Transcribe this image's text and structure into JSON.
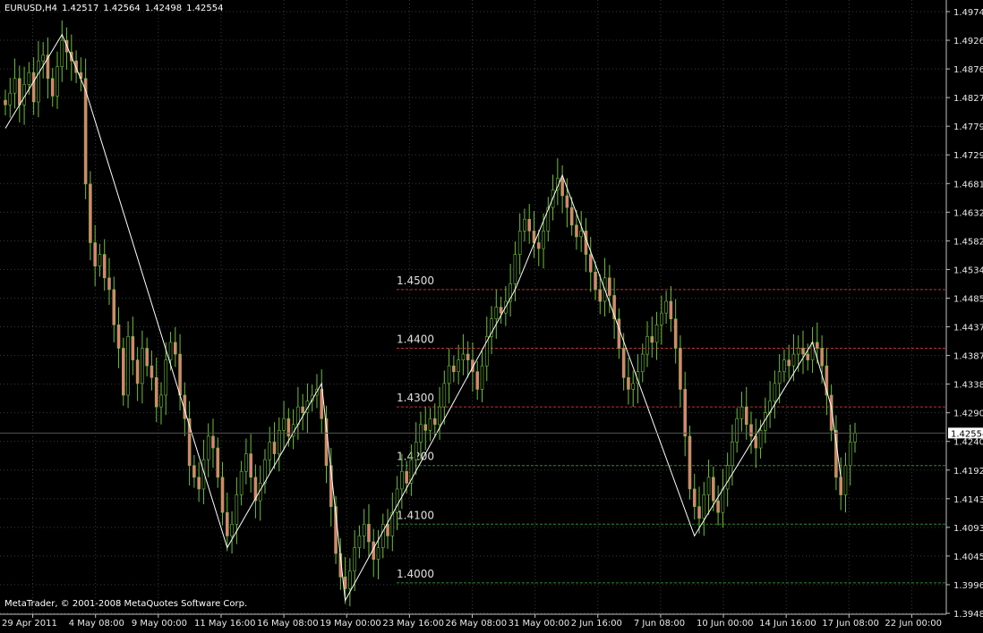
{
  "header": {
    "symbol": "EURUSD,H4",
    "open": "1.42517",
    "high": "1.42564",
    "low": "1.42498",
    "close": "1.42554"
  },
  "footer": "MetaTrader, © 2001-2008 MetaQuotes Software Corp.",
  "colors": {
    "background": "#000000",
    "grid": "#3a3a3a",
    "axis": "#c0c0c0",
    "candle": "#6fbf3a",
    "bull_body": "#6fbf3a",
    "bear_body": "#f07878",
    "zigzag": "#ffffff",
    "level_red": "#c03030",
    "level_green": "#2e8b2e",
    "price_tag_bg": "#ffffff"
  },
  "chart_data": {
    "type": "candlestick",
    "ylim": [
      1.3948,
      1.4974
    ],
    "y_ticks": [
      "1.49740",
      "1.49260",
      "1.48765",
      "1.48270",
      "1.47790",
      "1.47295",
      "1.46815",
      "1.46320",
      "1.45825",
      "1.45345",
      "1.44850",
      "1.44370",
      "1.43875",
      "1.43380",
      "1.42900",
      "1.42405",
      "1.41925",
      "1.41430",
      "1.40935",
      "1.40455",
      "1.39960",
      "1.39480"
    ],
    "x_ticks": [
      "29 Apr 2011",
      "4 May 08:00",
      "9 May 00:00",
      "11 May 16:00",
      "16 May 08:00",
      "19 May 00:00",
      "23 May 16:00",
      "26 May 08:00",
      "31 May 00:00",
      "2 Jun 16:00",
      "7 Jun 08:00",
      "10 Jun 00:00",
      "14 Jun 16:00",
      "17 Jun 08:00",
      "22 Jun 00:00"
    ],
    "current_price": "1.42554",
    "levels": [
      {
        "label": "1.4500",
        "price": 1.45,
        "color": "red"
      },
      {
        "label": "1.4400",
        "price": 1.44,
        "color": "red"
      },
      {
        "label": "1.4300",
        "price": 1.43,
        "color": "red"
      },
      {
        "label": "1.4200",
        "price": 1.42,
        "color": "green"
      },
      {
        "label": "1.4100",
        "price": 1.41,
        "color": "green"
      },
      {
        "label": "1.4000",
        "price": 1.4,
        "color": "green"
      }
    ],
    "zigzag_prices": [
      1.4775,
      1.4935,
      1.484,
      1.406,
      1.434,
      1.397,
      1.45,
      1.4695,
      1.45,
      1.408,
      1.441,
      1.43,
      1.418
    ],
    "closes": [
      1.4815,
      1.4835,
      1.486,
      1.4815,
      1.485,
      1.487,
      1.482,
      1.489,
      1.49,
      1.486,
      1.483,
      1.488,
      1.4925,
      1.4905,
      1.489,
      1.487,
      1.486,
      1.468,
      1.458,
      1.454,
      1.456,
      1.452,
      1.45,
      1.444,
      1.44,
      1.432,
      1.442,
      1.438,
      1.434,
      1.44,
      1.437,
      1.435,
      1.43,
      1.432,
      1.438,
      1.441,
      1.439,
      1.432,
      1.428,
      1.42,
      1.418,
      1.416,
      1.421,
      1.425,
      1.423,
      1.418,
      1.412,
      1.408,
      1.41,
      1.415,
      1.419,
      1.422,
      1.418,
      1.414,
      1.417,
      1.421,
      1.424,
      1.422,
      1.426,
      1.428,
      1.425,
      1.427,
      1.43,
      1.429,
      1.431,
      1.432,
      1.433,
      1.428,
      1.42,
      1.413,
      1.405,
      1.401,
      1.399,
      1.402,
      1.406,
      1.408,
      1.41,
      1.407,
      1.404,
      1.406,
      1.41,
      1.408,
      1.412,
      1.416,
      1.419,
      1.417,
      1.421,
      1.424,
      1.427,
      1.426,
      1.428,
      1.427,
      1.43,
      1.434,
      1.437,
      1.436,
      1.438,
      1.439,
      1.438,
      1.436,
      1.433,
      1.437,
      1.442,
      1.445,
      1.447,
      1.446,
      1.448,
      1.451,
      1.456,
      1.46,
      1.462,
      1.46,
      1.458,
      1.457,
      1.46,
      1.464,
      1.467,
      1.469,
      1.466,
      1.464,
      1.461,
      1.459,
      1.46,
      1.456,
      1.453,
      1.45,
      1.448,
      1.452,
      1.449,
      1.445,
      1.44,
      1.435,
      1.433,
      1.434,
      1.436,
      1.439,
      1.442,
      1.441,
      1.444,
      1.446,
      1.448,
      1.445,
      1.44,
      1.433,
      1.425,
      1.416,
      1.413,
      1.411,
      1.415,
      1.418,
      1.414,
      1.412,
      1.416,
      1.42,
      1.424,
      1.428,
      1.43,
      1.427,
      1.425,
      1.423,
      1.426,
      1.429,
      1.431,
      1.434,
      1.436,
      1.438,
      1.437,
      1.439,
      1.44,
      1.439,
      1.438,
      1.441,
      1.44,
      1.437,
      1.432,
      1.426,
      1.418,
      1.415,
      1.42,
      1.424,
      1.4255
    ]
  }
}
